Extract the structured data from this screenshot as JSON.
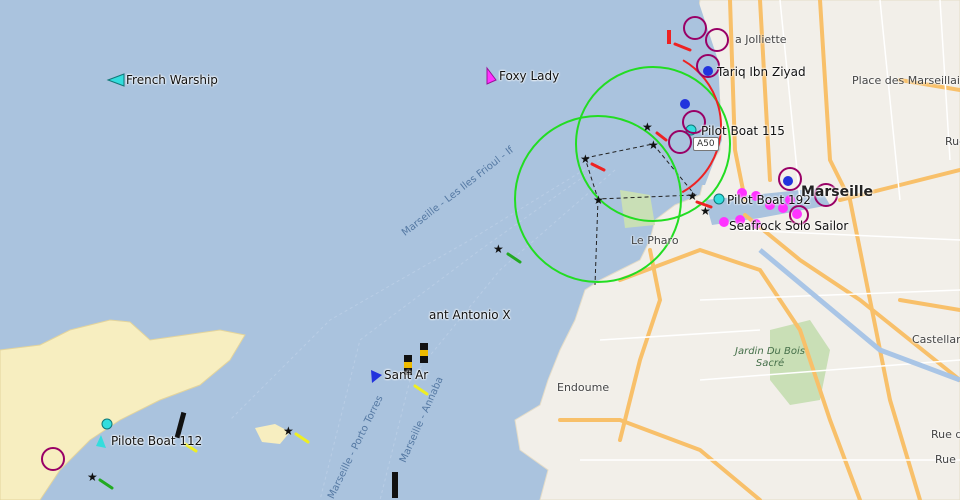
{
  "vessels": {
    "french_warship": "French Warship",
    "foxy_lady": "Foxy Lady",
    "tariq": "Tariq Ibn Ziyad",
    "pilot115": "Pilot Boat 115",
    "pilot192": "Pilot Boat 192",
    "seafrock": "Seafrock Solo Sailor",
    "sant_antonio": "ant Antonio X",
    "sant_ar": "Sant Ar",
    "pilote112": "Pilote Boat 112"
  },
  "places": {
    "city": "Marseille",
    "la_joliette": "a Jolliette",
    "place_marseillaise": "Place des Marseillaise",
    "le_pharo": "Le Pharo",
    "endoume": "Endoume",
    "jardin": "Jardin Du Bois Sacré",
    "castellane": "Castellan",
    "rue1": "Rue",
    "rue2": "Rue d",
    "rue3": "Rue"
  },
  "roads": {
    "a50": "A50"
  },
  "sea_routes": {
    "frioul": "Marseille - Les Iles Frioul - If",
    "porto_torres": "Marseille - Porto Torres",
    "annaba": "Marseille - Annaba"
  },
  "colors": {
    "sea": "#aac3de",
    "land": "#f2efe9",
    "island": "#f7eec0",
    "road": "#f8c06a",
    "zone_green": "#22dd22",
    "zone_red": "#ee2222",
    "tanker": "#ff00ff",
    "pilot": "#33dddd",
    "cargo": "#2233dd"
  }
}
